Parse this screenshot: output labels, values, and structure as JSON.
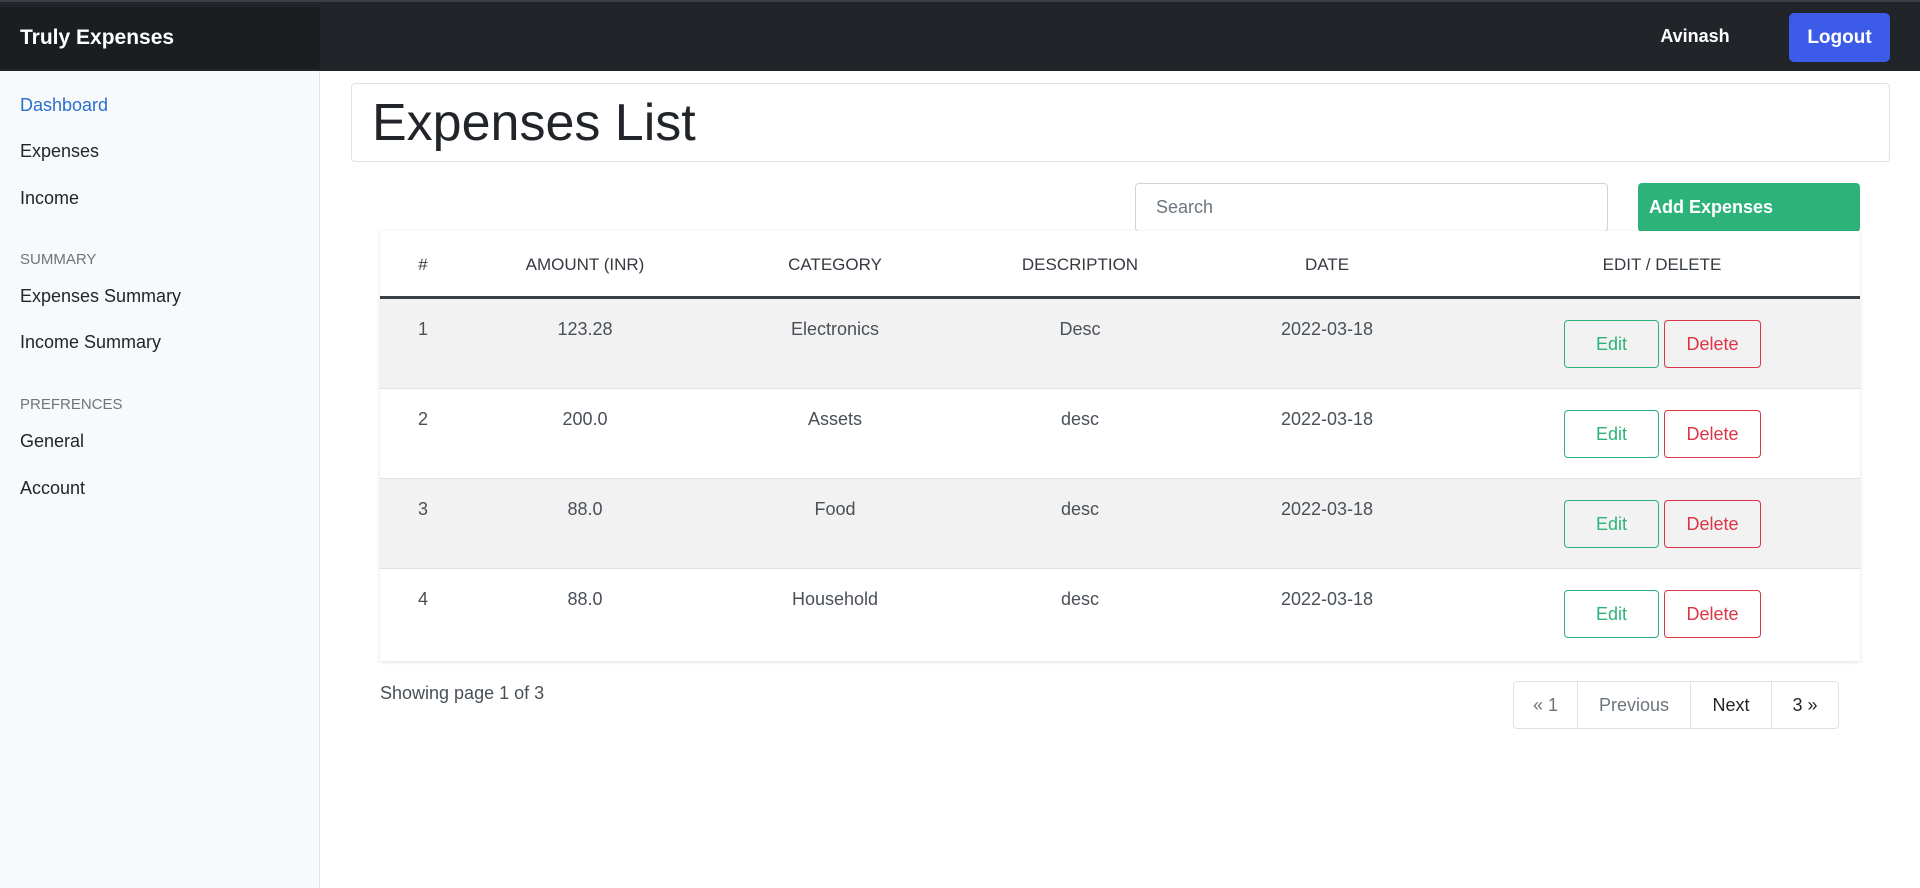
{
  "app": {
    "brand": "Truly Expenses",
    "user": "Avinash",
    "logout_label": "Logout"
  },
  "sidebar": {
    "items": [
      {
        "label": "Dashboard",
        "active": true
      },
      {
        "label": "Expenses"
      },
      {
        "label": "Income"
      }
    ],
    "summary_heading": "SUMMARY",
    "summary_items": [
      {
        "label": "Expenses Summary"
      },
      {
        "label": "Income Summary"
      }
    ],
    "prefs_heading": "PREFRENCES",
    "prefs_items": [
      {
        "label": "General"
      },
      {
        "label": "Account"
      }
    ]
  },
  "main": {
    "title": "Expenses List",
    "search_placeholder": "Search",
    "search_value": "",
    "add_label": "Add Expenses"
  },
  "table": {
    "headers": [
      "#",
      "AMOUNT (INR)",
      "CATEGORY",
      "DESCRIPTION",
      "DATE",
      "EDIT / DELETE"
    ],
    "rows": [
      {
        "num": "1",
        "amount": "123.28",
        "category": "Electronics",
        "description": "Desc",
        "date": "2022-03-18"
      },
      {
        "num": "2",
        "amount": "200.0",
        "category": "Assets",
        "description": "desc",
        "date": "2022-03-18"
      },
      {
        "num": "3",
        "amount": "88.0",
        "category": "Food",
        "description": "desc",
        "date": "2022-03-18"
      },
      {
        "num": "4",
        "amount": "88.0",
        "category": "Household",
        "description": "desc",
        "date": "2022-03-18"
      }
    ],
    "edit_label": "Edit",
    "delete_label": "Delete"
  },
  "pagination": {
    "info": "Showing page 1 of 3",
    "first": "« 1",
    "previous": "Previous",
    "next": "Next",
    "last": "3 »"
  },
  "colors": {
    "topbar": "#212529",
    "primary": "#3b5be8",
    "success": "#2db37a",
    "danger": "#dc3545",
    "link": "#2a6ecf"
  }
}
